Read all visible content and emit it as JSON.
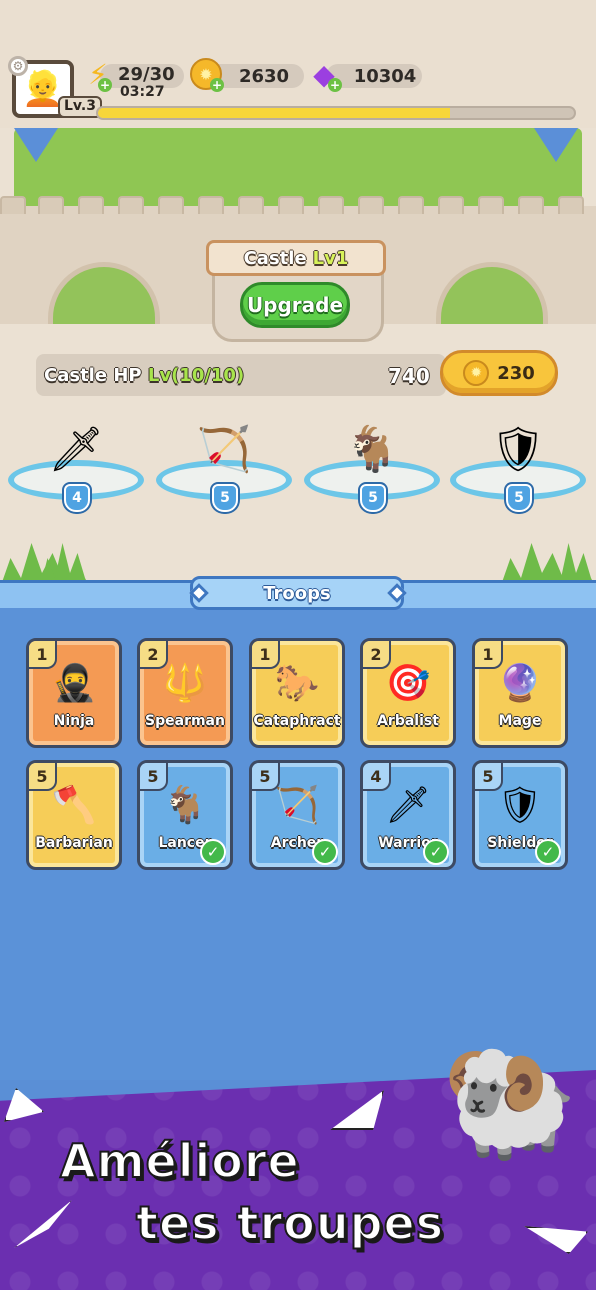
{
  "hud": {
    "level": "Lv.3",
    "energy": "29/30",
    "energy_timer": "03:27",
    "gold": "2630",
    "gems": "10304",
    "xp_fraction": 0.74
  },
  "castle": {
    "title": "Castle",
    "level": "Lv1",
    "upgrade_label": "Upgrade",
    "hp_label": "Castle HP",
    "hp_level": "Lv(10/10)",
    "hp_value": "740",
    "upgrade_cost": "230"
  },
  "deployed": [
    {
      "level": "4"
    },
    {
      "level": "5"
    },
    {
      "level": "5"
    },
    {
      "level": "5"
    }
  ],
  "troops": {
    "title": "Troops",
    "cards": [
      {
        "name": "Ninja",
        "level": "1"
      },
      {
        "name": "Spearman",
        "level": "2"
      },
      {
        "name": "Cataphract",
        "level": "1"
      },
      {
        "name": "Arbalist",
        "level": "2"
      },
      {
        "name": "Mage",
        "level": "1"
      },
      {
        "name": "Barbarian",
        "level": "5"
      },
      {
        "name": "Lancer",
        "level": "5"
      },
      {
        "name": "Archer",
        "level": "5"
      },
      {
        "name": "Warrior",
        "level": "4"
      },
      {
        "name": "Shielder",
        "level": "5"
      }
    ]
  },
  "promo": {
    "line1": "Améliore",
    "line2": "tes troupes"
  },
  "colors": {
    "orange_card": "#f49a54",
    "yellow_card": "#f6cd58",
    "blue_card": "#6aaee6",
    "upgrade_green": "#5fcf4a",
    "promo_purple": "#6b2fb0"
  }
}
